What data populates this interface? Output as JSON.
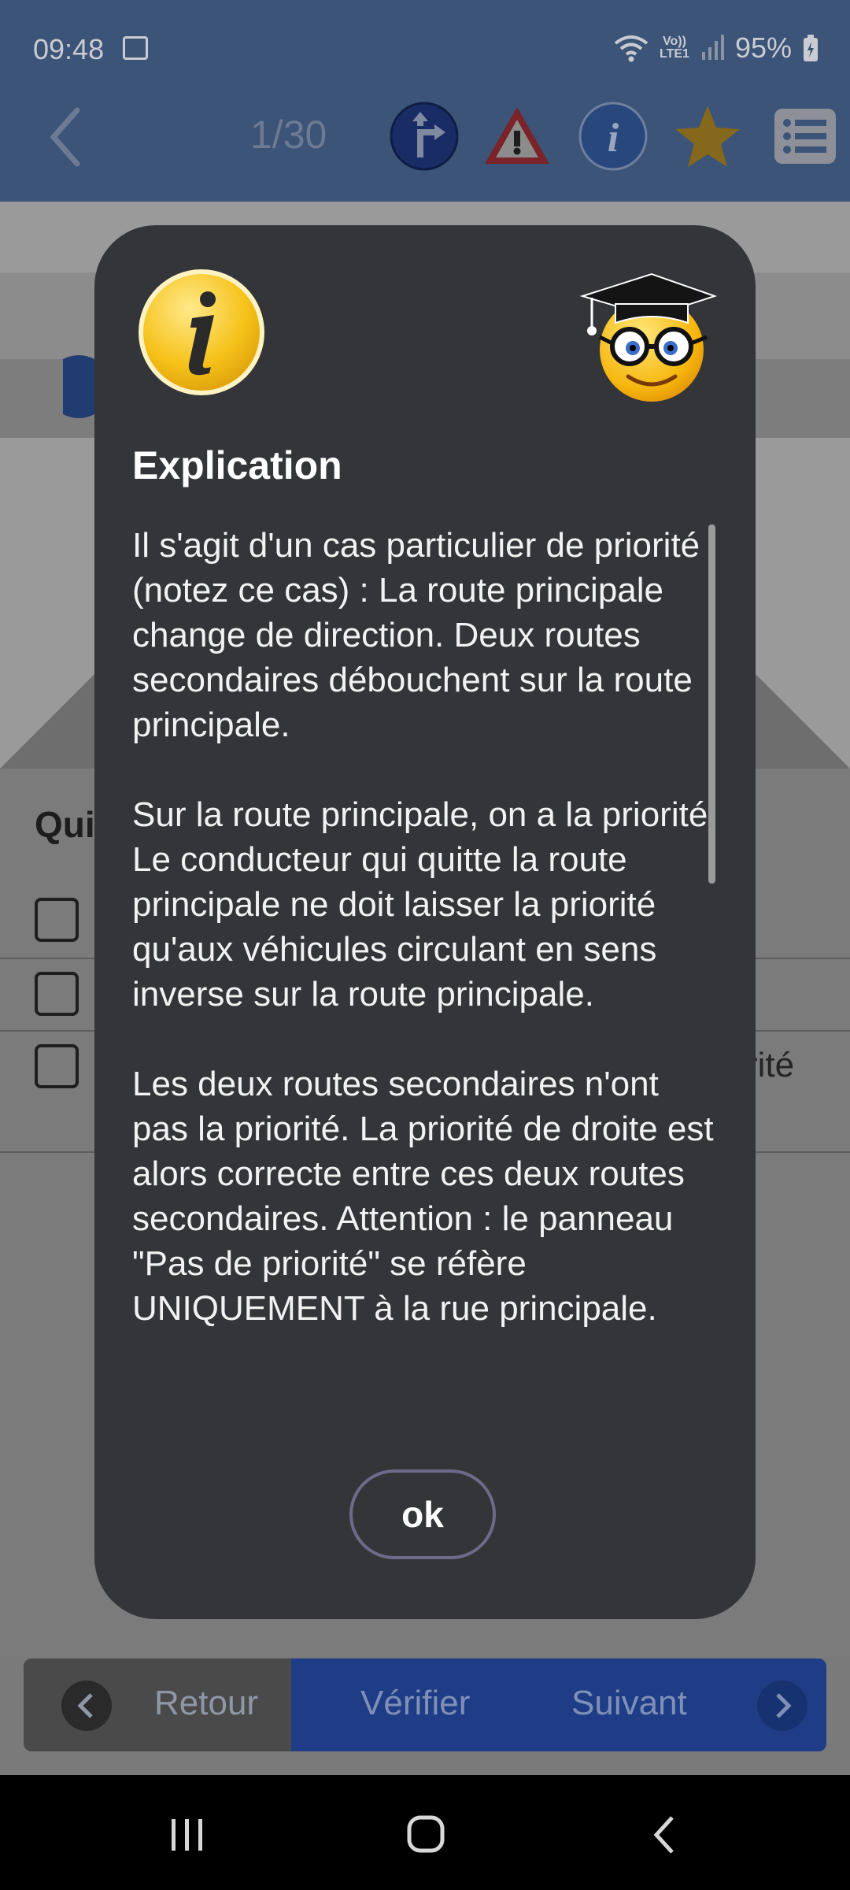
{
  "status_bar": {
    "time": "09:48",
    "volte": "Vo))\nLTE1",
    "battery": "95%"
  },
  "toolbar": {
    "counter": "1/30"
  },
  "question": {
    "stub": "Qui",
    "answer_tail": "rité"
  },
  "modal": {
    "title": "Explication",
    "paragraphs": [
      "Il s'agit d'un cas particulier de priorité (notez ce cas) : La route principale change de direction. Deux routes secondaires débouchent sur la route principale.",
      "Sur la route principale, on a la priorité. Le conducteur qui quitte la route principale ne doit laisser la priorité qu'aux véhicules circulant en sens inverse sur la route principale.",
      "Les deux routes secondaires n'ont pas la priorité. La priorité de droite est alors correcte entre ces deux routes secondaires. Attention : le panneau \"Pas de priorité\" se réfère UNIQUEMENT à la rue principale."
    ],
    "ok_label": "ok"
  },
  "bottom_bar": {
    "back_label": "Retour",
    "verify_label": "Vérifier",
    "next_label": "Suivant"
  },
  "icons": {
    "status": [
      "gallery-icon",
      "wifi-icon",
      "signal-icon",
      "battery-icon"
    ],
    "toolbar": [
      "back-icon",
      "priority-road-sign-icon",
      "warning-triangle-icon",
      "info-icon",
      "star-icon",
      "list-icon"
    ],
    "modal": [
      "info-icon",
      "graduate-smiley-icon"
    ],
    "nav": [
      "recents-icon",
      "home-icon",
      "back-icon"
    ]
  },
  "colors": {
    "header_bg": "#3b5478",
    "modal_bg": "#343538",
    "verify_bg": "#1f3d86",
    "info_yellow": "#f6c21a"
  }
}
